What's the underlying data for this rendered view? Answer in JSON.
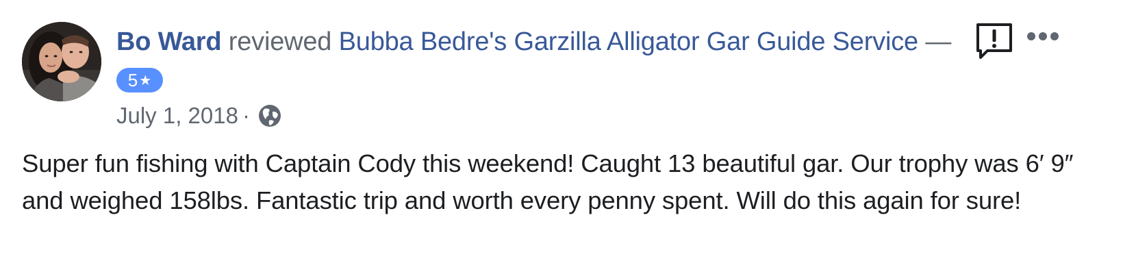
{
  "post": {
    "author": "Bo Ward",
    "verb": "reviewed",
    "page_name": "Bubba Bedre's Garzilla Alligator Gar Guide Service",
    "dash": "—",
    "rating": "5",
    "star_glyph": "★",
    "date": "July 1, 2018",
    "separator": "·",
    "privacy_icon": "globe-icon",
    "body": "Super fun fishing with Captain Cody this weekend! Caught 13 beautiful gar. Our trophy was 6′ 9″ and weighed 158lbs. Fantastic trip and worth every penny spent. Will do this again for sure!"
  },
  "icons": {
    "report": "report-icon",
    "more": "more-options-icon"
  },
  "colors": {
    "link": "#385898",
    "secondary_text": "#606770",
    "body_text": "#1c1e21",
    "rating_badge": "#5890ff"
  }
}
